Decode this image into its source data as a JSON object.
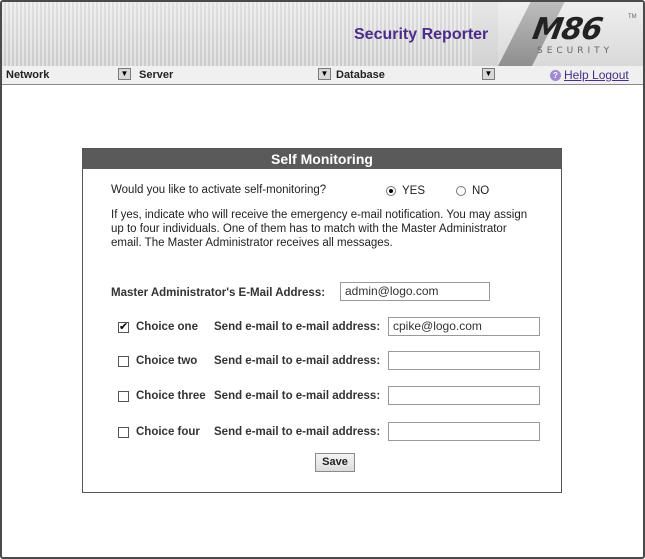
{
  "header": {
    "app_title": "Security Reporter",
    "logo": "M86",
    "logo_sub": "SECURITY",
    "logo_tm": "TM"
  },
  "menu": {
    "network": "Network",
    "server": "Server",
    "database": "Database",
    "help": "Help",
    "logout": "Logout",
    "dropdown_glyph": "▼",
    "help_glyph": "?"
  },
  "panel": {
    "title": "Self Monitoring",
    "question": "Would you like to activate self-monitoring?",
    "yes": "YES",
    "no": "NO",
    "selected": "YES",
    "description": "If yes, indicate who will receive the emergency e-mail notification. You may assign up to four individuals. One of them has to match with the Master Administrator email. The Master Administrator receives all messages.",
    "master_label": "Master Administrator's E-Mail Address:",
    "master_value": "admin@logo.com",
    "send_label": "Send e-mail to e-mail address:",
    "choices": [
      {
        "label": "Choice one",
        "checked": true,
        "value": "cpike@logo.com"
      },
      {
        "label": "Choice two",
        "checked": false,
        "value": ""
      },
      {
        "label": "Choice three",
        "checked": false,
        "value": ""
      },
      {
        "label": "Choice four",
        "checked": false,
        "value": ""
      }
    ],
    "check_glyph": "✔",
    "save_label": "Save"
  },
  "colors": {
    "accent": "#4a2c8a",
    "panel_header": "#5a5a5a"
  }
}
